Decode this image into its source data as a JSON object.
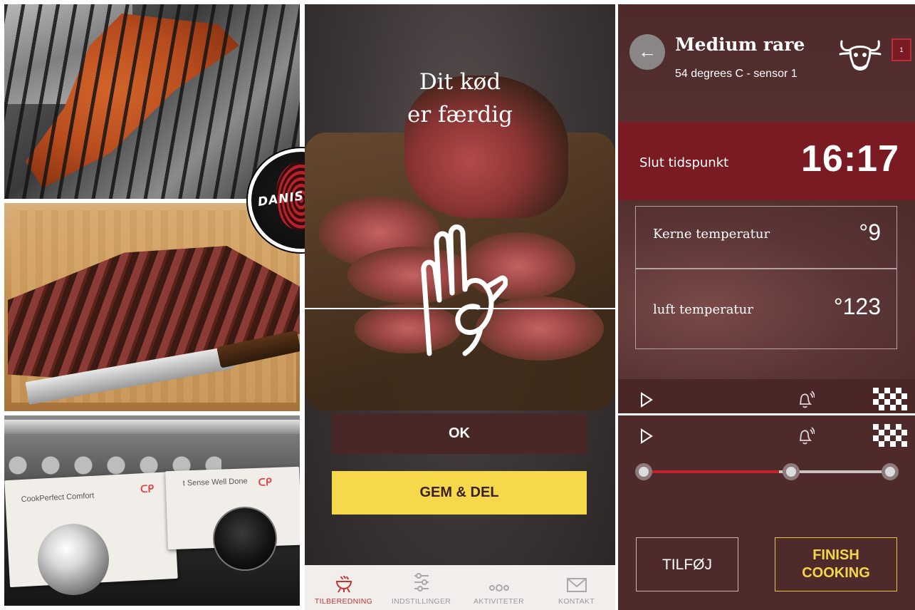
{
  "collage": {
    "logo": {
      "text": "DANISH BBQ"
    },
    "product_box_1": {
      "title": "CookPerfect Comfort"
    },
    "product_box_2": {
      "title": "t Sense Well Done"
    }
  },
  "middle": {
    "heading_line1": "Dit kød",
    "heading_line2": "er færdig",
    "ok_button": "OK",
    "share_button": "GEM & DEL",
    "nav": [
      {
        "label": "TILBEREDNING",
        "icon": "grill-icon",
        "active": true
      },
      {
        "label": "INDSTILLINGER",
        "icon": "sliders-icon",
        "active": false
      },
      {
        "label": "AKTIVITETER",
        "icon": "activity-icon",
        "active": false
      },
      {
        "label": "KONTAKT",
        "icon": "mail-icon",
        "active": false
      }
    ],
    "colors": {
      "active_nav": "#c2362f",
      "ok_button": "#4a2727",
      "share_button": "#f6d94a"
    }
  },
  "right": {
    "back_icon": "←",
    "title": "Medium rare",
    "subtitle": "54 degrees C - sensor 1",
    "sensor_tag": "1",
    "end_label": "Slut tidspunkt",
    "end_time": "16:17",
    "core_label": "Kerne temperatur",
    "core_value": "°9",
    "air_label": "luft temperatur",
    "air_value": "°123",
    "progress": 0.55,
    "alarm_button": "TILFØJ ALARM",
    "finish_button": "FINISH\nCOOKING",
    "colors": {
      "background": "#4e2a2a",
      "accent": "#7a1a22",
      "finish": "#f3d64b"
    }
  }
}
